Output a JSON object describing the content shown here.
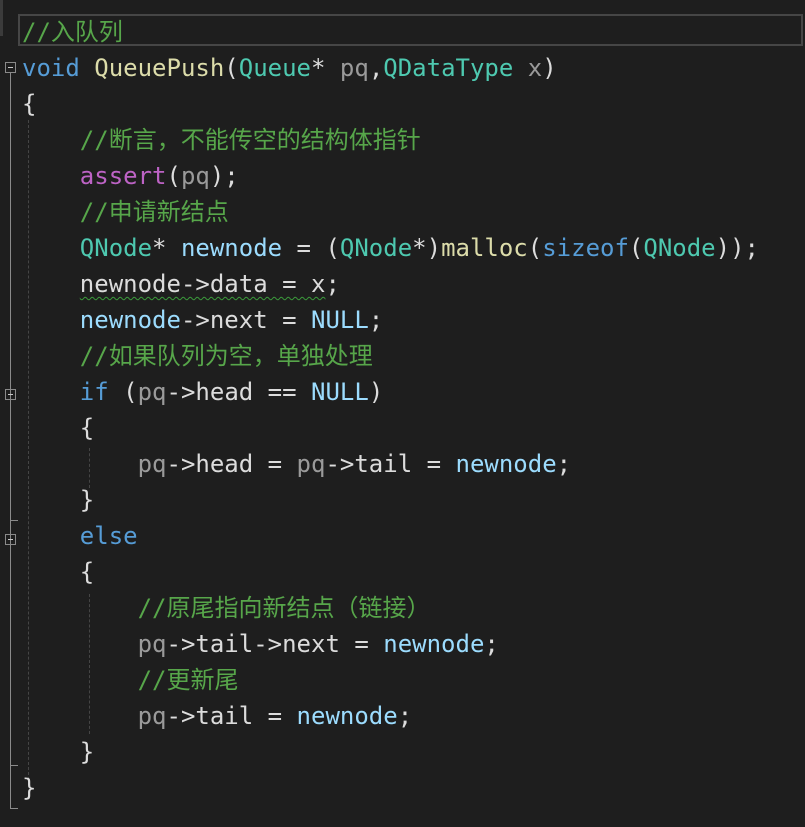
{
  "editor": {
    "lines": [
      {
        "segments": [
          {
            "t": "//入队列",
            "c": "c-comment"
          }
        ]
      },
      {
        "segments": [
          {
            "t": "void",
            "c": "c-kw"
          },
          {
            "t": " ",
            "c": "c-text"
          },
          {
            "t": "QueuePush",
            "c": "c-fn"
          },
          {
            "t": "(",
            "c": "c-text"
          },
          {
            "t": "Queue",
            "c": "c-type"
          },
          {
            "t": "* ",
            "c": "c-text"
          },
          {
            "t": "pq",
            "c": "c-param"
          },
          {
            "t": ",",
            "c": "c-text"
          },
          {
            "t": "QDataType",
            "c": "c-type"
          },
          {
            "t": " ",
            "c": "c-text"
          },
          {
            "t": "x",
            "c": "c-param"
          },
          {
            "t": ")",
            "c": "c-text"
          }
        ]
      },
      {
        "segments": [
          {
            "t": "{",
            "c": "c-text"
          }
        ]
      },
      {
        "segments": [
          {
            "t": "    //断言，不能传空的结构体指针",
            "c": "c-comment"
          }
        ]
      },
      {
        "segments": [
          {
            "t": "    ",
            "c": "c-text"
          },
          {
            "t": "assert",
            "c": "c-macro"
          },
          {
            "t": "(",
            "c": "c-text"
          },
          {
            "t": "pq",
            "c": "c-param"
          },
          {
            "t": ");",
            "c": "c-text"
          }
        ]
      },
      {
        "segments": [
          {
            "t": "    //申请新结点",
            "c": "c-comment"
          }
        ]
      },
      {
        "segments": [
          {
            "t": "    ",
            "c": "c-text"
          },
          {
            "t": "QNode",
            "c": "c-type"
          },
          {
            "t": "* ",
            "c": "c-text"
          },
          {
            "t": "newnode",
            "c": "c-local"
          },
          {
            "t": " = (",
            "c": "c-text"
          },
          {
            "t": "QNode",
            "c": "c-type"
          },
          {
            "t": "*)",
            "c": "c-text"
          },
          {
            "t": "malloc",
            "c": "c-fn"
          },
          {
            "t": "(",
            "c": "c-text"
          },
          {
            "t": "sizeof",
            "c": "c-kw"
          },
          {
            "t": "(",
            "c": "c-text"
          },
          {
            "t": "QNode",
            "c": "c-type"
          },
          {
            "t": "));",
            "c": "c-text"
          }
        ]
      },
      {
        "segments": [
          {
            "t": "    ",
            "c": "c-text"
          },
          {
            "t": "newnode->data = x",
            "c": "c-text",
            "squiggle": true
          },
          {
            "t": ";",
            "c": "c-text"
          }
        ]
      },
      {
        "segments": [
          {
            "t": "    ",
            "c": "c-text"
          },
          {
            "t": "newnode",
            "c": "c-local"
          },
          {
            "t": "->next = ",
            "c": "c-text"
          },
          {
            "t": "NULL",
            "c": "c-local"
          },
          {
            "t": ";",
            "c": "c-text"
          }
        ]
      },
      {
        "segments": [
          {
            "t": "    //如果队列为空，单独处理",
            "c": "c-comment"
          }
        ]
      },
      {
        "segments": [
          {
            "t": "    ",
            "c": "c-text"
          },
          {
            "t": "if",
            "c": "c-kw"
          },
          {
            "t": " (",
            "c": "c-text"
          },
          {
            "t": "pq",
            "c": "c-param"
          },
          {
            "t": "->head == ",
            "c": "c-text"
          },
          {
            "t": "NULL",
            "c": "c-local"
          },
          {
            "t": ")",
            "c": "c-text"
          }
        ]
      },
      {
        "segments": [
          {
            "t": "    {",
            "c": "c-text"
          }
        ]
      },
      {
        "segments": [
          {
            "t": "        ",
            "c": "c-text"
          },
          {
            "t": "pq",
            "c": "c-param"
          },
          {
            "t": "->head = ",
            "c": "c-text"
          },
          {
            "t": "pq",
            "c": "c-param"
          },
          {
            "t": "->tail = ",
            "c": "c-text"
          },
          {
            "t": "newnode",
            "c": "c-local"
          },
          {
            "t": ";",
            "c": "c-text"
          }
        ]
      },
      {
        "segments": [
          {
            "t": "    }",
            "c": "c-text"
          }
        ]
      },
      {
        "segments": [
          {
            "t": "    ",
            "c": "c-text"
          },
          {
            "t": "else",
            "c": "c-kw"
          }
        ]
      },
      {
        "segments": [
          {
            "t": "    {",
            "c": "c-text"
          }
        ]
      },
      {
        "segments": [
          {
            "t": "        //原尾指向新结点（链接）",
            "c": "c-comment"
          }
        ]
      },
      {
        "segments": [
          {
            "t": "        ",
            "c": "c-text"
          },
          {
            "t": "pq",
            "c": "c-param"
          },
          {
            "t": "->tail->next = ",
            "c": "c-text"
          },
          {
            "t": "newnode",
            "c": "c-local"
          },
          {
            "t": ";",
            "c": "c-text"
          }
        ]
      },
      {
        "segments": [
          {
            "t": "        //更新尾",
            "c": "c-comment"
          }
        ]
      },
      {
        "segments": [
          {
            "t": "        ",
            "c": "c-text"
          },
          {
            "t": "pq",
            "c": "c-param"
          },
          {
            "t": "->tail = ",
            "c": "c-text"
          },
          {
            "t": "newnode",
            "c": "c-local"
          },
          {
            "t": ";",
            "c": "c-text"
          }
        ]
      },
      {
        "segments": [
          {
            "t": "    }",
            "c": "c-text"
          }
        ]
      },
      {
        "segments": [
          {
            "t": "}",
            "c": "c-text"
          }
        ]
      }
    ],
    "colors": {
      "background": "#1e1e1e",
      "comment": "#57a64a",
      "keyword": "#569cd6",
      "function": "#dcdcaa",
      "type": "#4ec9b0",
      "parameter": "#9a9a9a",
      "local": "#9cdcfe",
      "text": "#dcdcdc",
      "macro": "#bd63c5"
    },
    "fold_markers": [
      "collapse-icon",
      "collapse-icon",
      "collapse-icon"
    ]
  }
}
